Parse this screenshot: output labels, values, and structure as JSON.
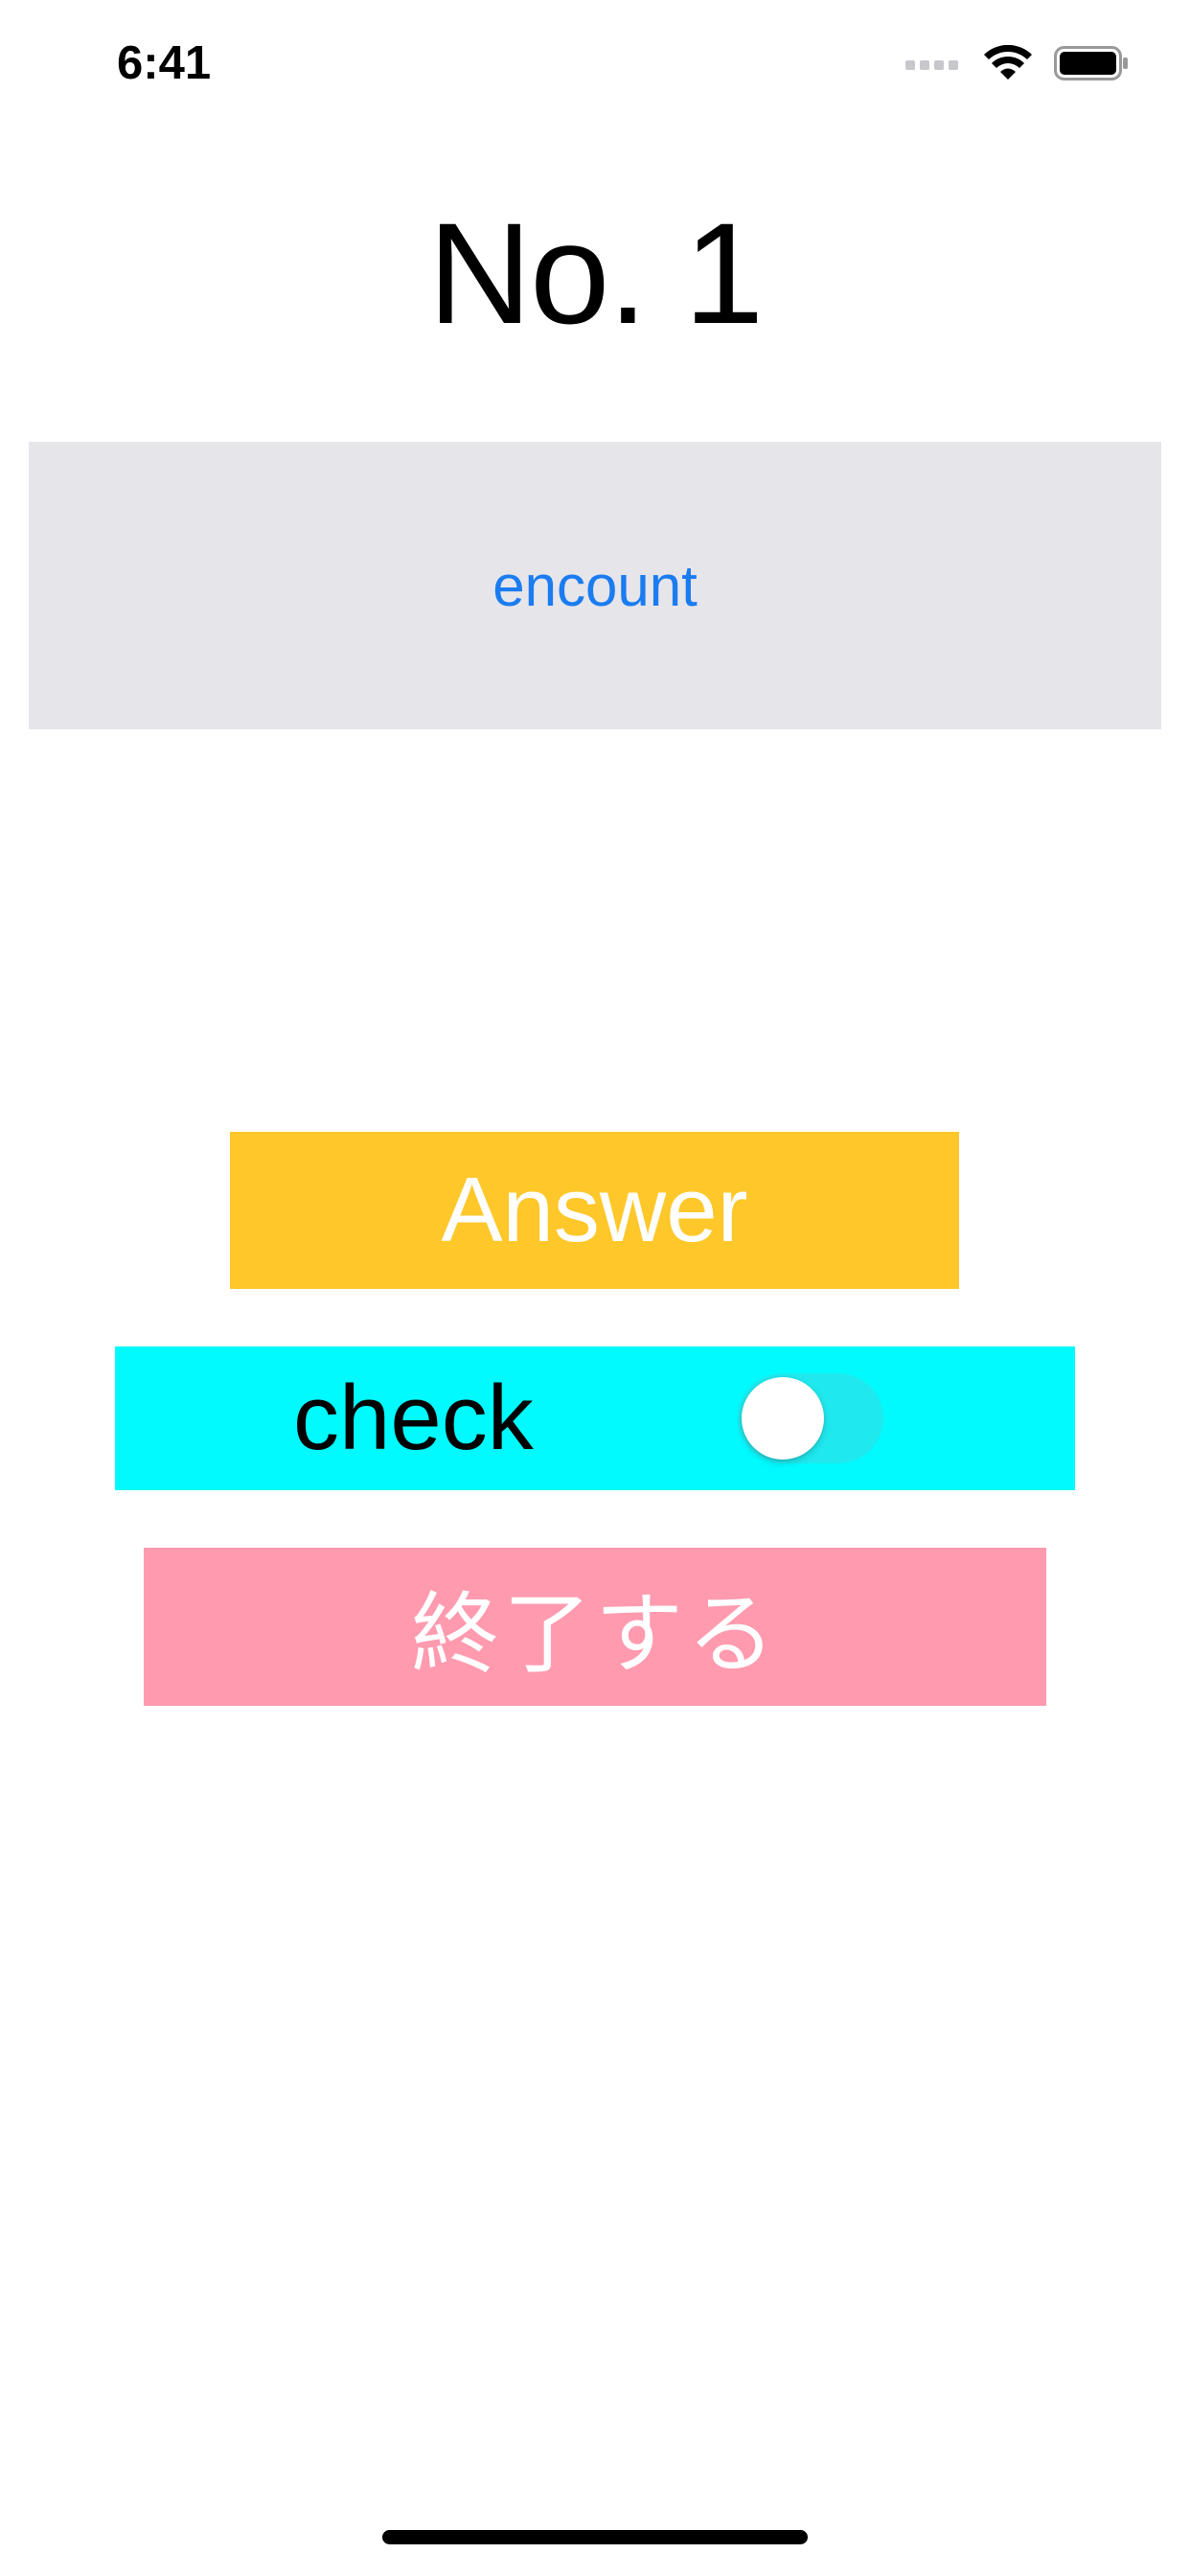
{
  "status_bar": {
    "time": "6:41"
  },
  "title": "No. 1",
  "word_card": {
    "word": "encount"
  },
  "answer_button": {
    "label": "Answer",
    "color": "#FEC72A"
  },
  "check": {
    "label": "check",
    "toggle_on": false,
    "color": "#00FAFE"
  },
  "finish_button": {
    "label": "終了する",
    "color": "#FF9AAF"
  },
  "icons": [
    "signal-icon",
    "wifi-icon",
    "battery-icon"
  ]
}
